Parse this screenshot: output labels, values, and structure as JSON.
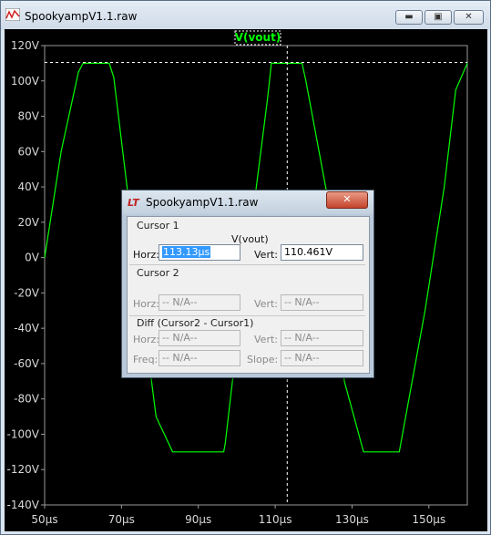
{
  "window": {
    "title": "SpookyampV1.1.raw",
    "buttons": {
      "minimize": "▬",
      "maximize": "▣",
      "close": "✕"
    }
  },
  "plot": {
    "trace_label": "V(vout)",
    "trace_color": "#00ff00",
    "background": "#000000",
    "grid_color": "#9a9a9a"
  },
  "chart_data": {
    "type": "line",
    "series": [
      {
        "name": "V(vout)",
        "x": [
          50,
          54.3,
          58.8,
          60.0,
          66.8,
          68.0,
          72.0,
          79.0,
          83.3,
          87.8,
          88.0,
          96.6,
          97.0,
          101.0,
          108.0,
          109.0,
          112.0,
          117.0,
          118.0,
          124.0,
          128.0,
          133.0,
          138.8,
          142.3,
          149.0,
          154.0,
          157.0,
          160.0
        ],
        "y": [
          0,
          60,
          105,
          110,
          110,
          102,
          30,
          -90,
          -110,
          -110,
          -110,
          -110,
          -105,
          -30,
          90,
          110,
          110,
          110,
          100,
          30,
          -70,
          -110,
          -110,
          -110,
          -30,
          40,
          95,
          110
        ]
      }
    ],
    "xlabel": "",
    "ylabel": "",
    "xlim": [
      50,
      160
    ],
    "ylim": [
      -140,
      120
    ],
    "x_ticks": [
      "50µs",
      "70µs",
      "90µs",
      "110µs",
      "130µs",
      "150µs"
    ],
    "y_ticks": [
      "120V",
      "100V",
      "80V",
      "60V",
      "40V",
      "20V",
      "0V",
      "-20V",
      "-40V",
      "-60V",
      "-80V",
      "-100V",
      "-120V",
      "-140V"
    ],
    "grid": false,
    "cursor_x": 113.13,
    "cursor_y": 110.461
  },
  "dialog": {
    "title": "SpookyampV1.1.raw",
    "icon": "LT",
    "close": "✕",
    "cursor1": {
      "label": "Cursor 1",
      "trace": "V(vout)",
      "horz_label": "Horz:",
      "horz_value": "113.13µs",
      "vert_label": "Vert:",
      "vert_value": "110.461V"
    },
    "cursor2": {
      "label": "Cursor 2",
      "horz_label": "Horz:",
      "horz_value": "-- N/A--",
      "vert_label": "Vert:",
      "vert_value": "-- N/A--"
    },
    "diff": {
      "label": "Diff (Cursor2 - Cursor1)",
      "horz_label": "Horz:",
      "horz_value": "-- N/A--",
      "vert_label": "Vert:",
      "vert_value": "-- N/A--",
      "freq_label": "Freq:",
      "freq_value": "-- N/A--",
      "slope_label": "Slope:",
      "slope_value": "-- N/A--"
    }
  }
}
